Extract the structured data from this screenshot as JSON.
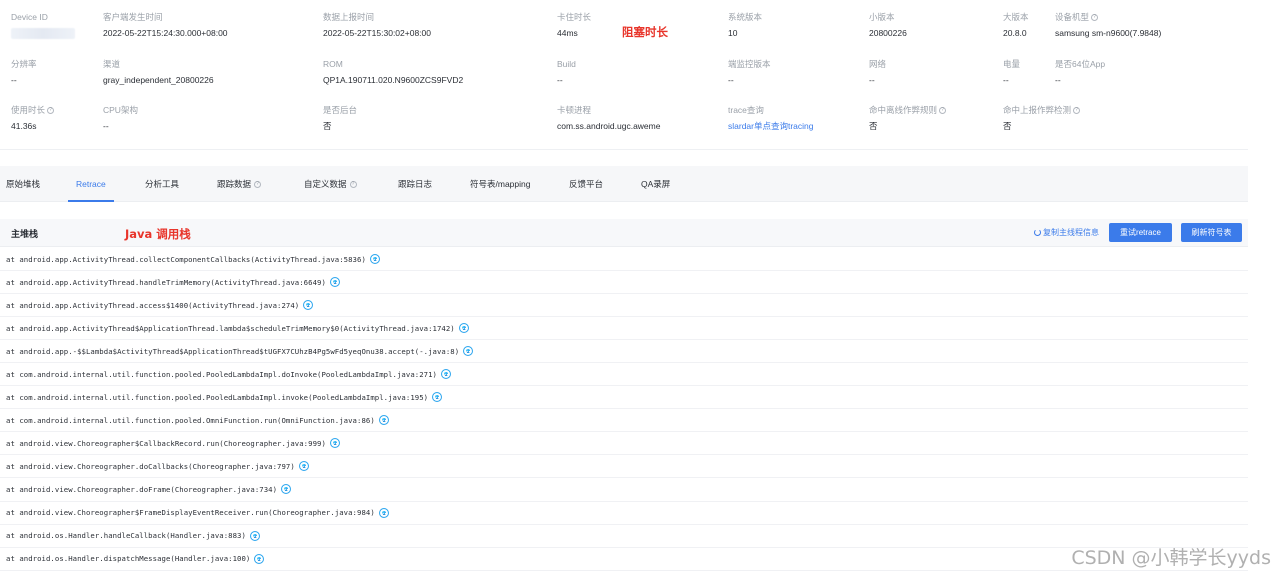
{
  "info": {
    "row0": [
      {
        "label": "Device ID",
        "value": "",
        "blurred": true
      },
      {
        "label": "客户端发生时间",
        "value": "2022-05-22T15:24:30.000+08:00"
      },
      {
        "label": "数据上报时间",
        "value": "2022-05-22T15:30:02+08:00"
      },
      {
        "label": "卡住时长",
        "value": "44ms"
      },
      {
        "label": "系统版本",
        "value": "10"
      },
      {
        "label": "小版本",
        "value": "20800226"
      },
      {
        "label": "大版本",
        "value": "20.8.0"
      },
      {
        "label": "设备机型",
        "value": "samsung sm-n9600(7.9848)",
        "help": true
      }
    ],
    "row1": [
      {
        "label": "分辨率",
        "value": "--"
      },
      {
        "label": "渠道",
        "value": "gray_independent_20800226"
      },
      {
        "label": "ROM",
        "value": "QP1A.190711.020.N9600ZCS9FVD2"
      },
      {
        "label": "Build",
        "value": "--"
      },
      {
        "label": "端监控版本",
        "value": "--"
      },
      {
        "label": "网络",
        "value": "--"
      },
      {
        "label": "电量",
        "value": "--"
      },
      {
        "label": "是否64位App",
        "value": "--"
      }
    ],
    "row2": [
      {
        "label": "使用时长",
        "value": "41.36s",
        "help": true
      },
      {
        "label": "CPU架构",
        "value": "--"
      },
      {
        "label": "是否后台",
        "value": "否"
      },
      {
        "label": "卡顿进程",
        "value": "com.ss.android.ugc.aweme"
      },
      {
        "label": "trace查询",
        "value": "slardar单点查询tracing",
        "link": true
      },
      {
        "label": "命中离线作弊规则",
        "value": "否",
        "help": true
      },
      {
        "label": "命中上报作弊检测",
        "value": "否",
        "help": true
      }
    ]
  },
  "annotations": {
    "block_duration": "阻塞时长",
    "java_stack": "Java 调用栈"
  },
  "tabs": [
    {
      "label": "原始堆栈",
      "active": false
    },
    {
      "label": "Retrace",
      "active": true
    },
    {
      "label": "分析工具",
      "active": false
    },
    {
      "label": "跟踪数据",
      "active": false,
      "help": true
    },
    {
      "label": "自定义数据",
      "active": false,
      "help": true
    },
    {
      "label": "跟踪日志",
      "active": false
    },
    {
      "label": "符号表/mapping",
      "active": false
    },
    {
      "label": "反馈平台",
      "active": false
    },
    {
      "label": "QA录屏",
      "active": false
    }
  ],
  "stack": {
    "title": "主堆栈",
    "copy_label": "复制主线程信息",
    "retrace_button": "重试retrace",
    "refresh_button": "刷新符号表",
    "frames": [
      "at android.app.ActivityThread.collectComponentCallbacks(ActivityThread.java:5836)",
      "at android.app.ActivityThread.handleTrimMemory(ActivityThread.java:6649)",
      "at android.app.ActivityThread.access$1400(ActivityThread.java:274)",
      "at android.app.ActivityThread$ApplicationThread.lambda$scheduleTrimMemory$0(ActivityThread.java:1742)",
      "at android.app.-$$Lambda$ActivityThread$ApplicationThread$tUGFX7CUhzB4Pg5wFd5yeqOnu38.accept(-.java:8)",
      "at com.android.internal.util.function.pooled.PooledLambdaImpl.doInvoke(PooledLambdaImpl.java:271)",
      "at com.android.internal.util.function.pooled.PooledLambdaImpl.invoke(PooledLambdaImpl.java:195)",
      "at com.android.internal.util.function.pooled.OmniFunction.run(OmniFunction.java:86)",
      "at android.view.Choreographer$CallbackRecord.run(Choreographer.java:999)",
      "at android.view.Choreographer.doCallbacks(Choreographer.java:797)",
      "at android.view.Choreographer.doFrame(Choreographer.java:734)",
      "at android.view.Choreographer$FrameDisplayEventReceiver.run(Choreographer.java:984)",
      "at android.os.Handler.handleCallback(Handler.java:883)",
      "at android.os.Handler.dispatchMessage(Handler.java:100)"
    ]
  },
  "watermark": "CSDN @小韩学长yyds",
  "colors": {
    "accent": "#3b7bea",
    "annotation": "#e8352b"
  }
}
